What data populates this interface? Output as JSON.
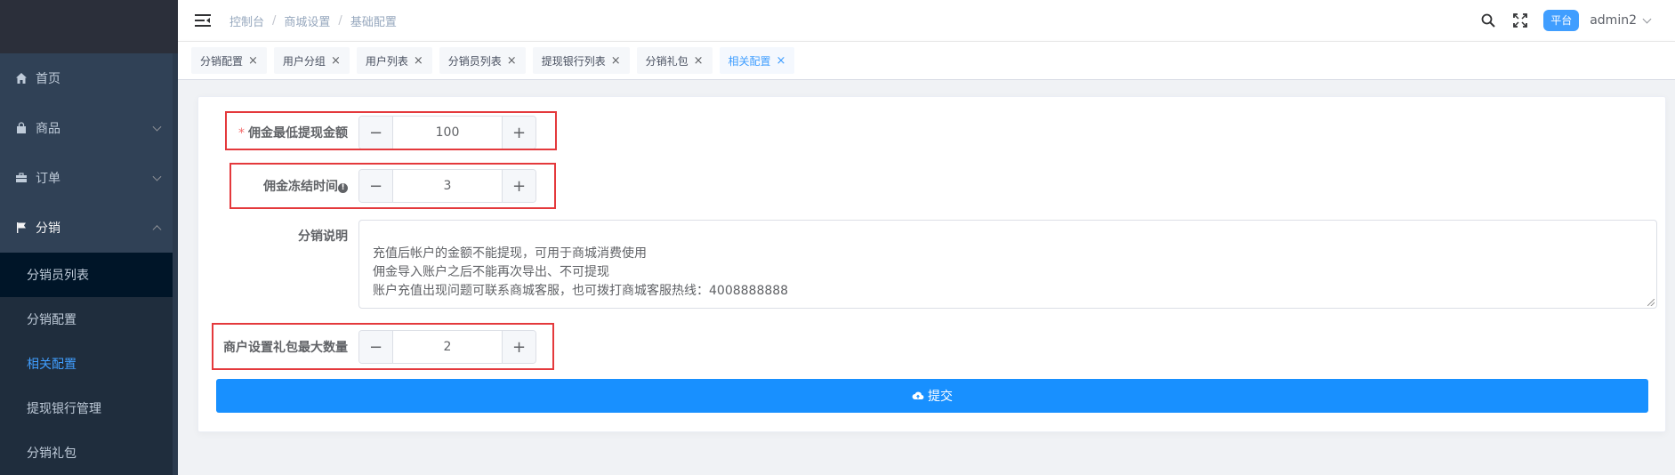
{
  "sidebar": {
    "items": [
      {
        "label": "首页",
        "icon": "home-icon"
      },
      {
        "label": "商品",
        "icon": "bag-icon"
      },
      {
        "label": "订单",
        "icon": "briefcase-icon"
      },
      {
        "label": "分销",
        "icon": "flag-icon"
      }
    ],
    "sub_items": [
      {
        "label": "分销员列表"
      },
      {
        "label": "分销配置"
      },
      {
        "label": "相关配置"
      },
      {
        "label": "提现银行管理"
      },
      {
        "label": "分销礼包"
      }
    ]
  },
  "navbar": {
    "breadcrumb": [
      "控制台",
      "商城设置",
      "基础配置"
    ],
    "breadcrumb_sep": "/",
    "platform_badge": "平台",
    "user": "admin2"
  },
  "tags": [
    {
      "label": "分销配置"
    },
    {
      "label": "用户分组"
    },
    {
      "label": "用户列表"
    },
    {
      "label": "分销员列表"
    },
    {
      "label": "提现银行列表"
    },
    {
      "label": "分销礼包"
    },
    {
      "label": "相关配置"
    }
  ],
  "tag_close": "×",
  "form": {
    "min_withdraw": {
      "required_mark": "*",
      "label": "佣金最低提现金额",
      "value": "100"
    },
    "freeze_time": {
      "label": "佣金冻结时间",
      "info": "!",
      "value": "3"
    },
    "description": {
      "label": "分销说明",
      "value": "充值后帐户的金额不能提现，可用于商城消费使用\n佣金导入账户之后不能再次导出、不可提现\n账户充值出现问题可联系商城客服，也可拨打商城客服热线：4008888888"
    },
    "max_gift": {
      "label": "商户设置礼包最大数量",
      "value": "2"
    },
    "minus": "−",
    "plus": "+",
    "submit_label": "提交"
  },
  "colors": {
    "sidebar_bg": "#304156",
    "accent": "#409eff",
    "submit": "#1890ff",
    "highlight_box": "#e4393c"
  }
}
